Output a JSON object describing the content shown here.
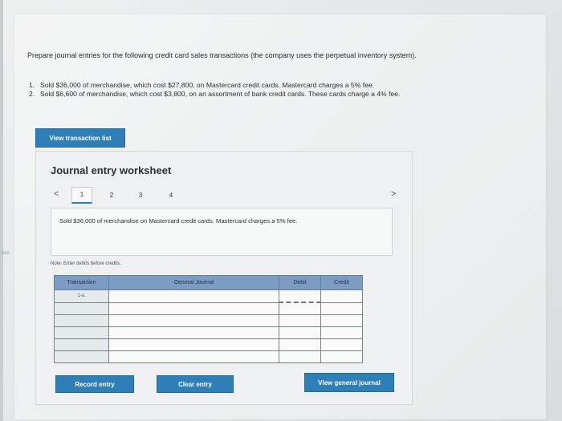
{
  "side_label": "ces",
  "instructions": "Prepare journal entries for the following credit card sales transactions (the company uses the perpetual inventory system).",
  "transactions": [
    {
      "num": "1.",
      "text": "Sold $36,000 of merchandise, which cost $27,800, on Mastercard credit cards. Mastercard charges a 5% fee."
    },
    {
      "num": "2.",
      "text": "Sold $6,600 of merchandise, which cost $3,800, on an assortment of bank credit cards. These cards charge a 4% fee."
    }
  ],
  "view_transaction_list_label": "View transaction list",
  "worksheet": {
    "title": "Journal entry worksheet",
    "prev_icon": "chevron-left-icon",
    "next_icon": "chevron-right-icon",
    "tabs": [
      "1",
      "2",
      "3",
      "4"
    ],
    "active_tab": "1",
    "description": "Sold $36,000 of merchandise on Mastercard credit cards. Mastercard charges a 5% fee.",
    "note": "Note: Enter debits before credits.",
    "columns": [
      "Transaction",
      "General Journal",
      "Debit",
      "Credit"
    ],
    "rows": [
      {
        "transaction": "1-a.",
        "account": "",
        "debit": "",
        "credit": ""
      },
      {
        "transaction": "",
        "account": "",
        "debit": "",
        "credit": ""
      },
      {
        "transaction": "",
        "account": "",
        "debit": "",
        "credit": ""
      },
      {
        "transaction": "",
        "account": "",
        "debit": "",
        "credit": ""
      },
      {
        "transaction": "",
        "account": "",
        "debit": "",
        "credit": ""
      },
      {
        "transaction": "",
        "account": "",
        "debit": "",
        "credit": ""
      }
    ],
    "record_entry_label": "Record entry",
    "clear_entry_label": "Clear entry",
    "view_general_journal_label": "View general journal"
  },
  "colors": {
    "accent": "#2e7fb8",
    "table_header": "#7d9cc4"
  }
}
